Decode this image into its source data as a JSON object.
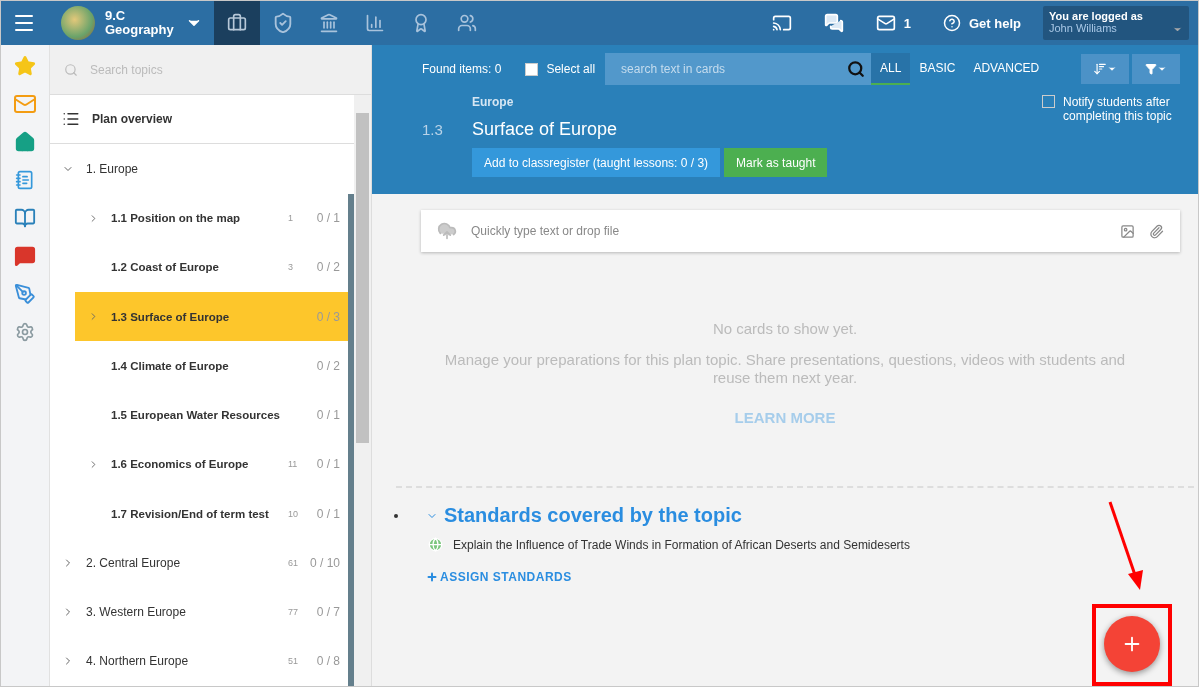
{
  "topbar": {
    "class_line1": "9.C",
    "class_line2": "Geography",
    "nav": [
      {
        "kind": "briefcase",
        "selected": true
      },
      {
        "kind": "shield",
        "selected": false
      },
      {
        "kind": "institution",
        "selected": false
      },
      {
        "kind": "chart",
        "selected": false
      },
      {
        "kind": "grade",
        "selected": false
      },
      {
        "kind": "students",
        "selected": false
      }
    ],
    "mail_count": "1",
    "help": "Get help",
    "login_label": "You are logged as",
    "user": "John Williams"
  },
  "rail": [
    {
      "kind": "star"
    },
    {
      "kind": "mail"
    },
    {
      "kind": "home"
    },
    {
      "kind": "notebook"
    },
    {
      "kind": "book"
    },
    {
      "kind": "chat"
    },
    {
      "kind": "pen"
    },
    {
      "kind": "settings"
    }
  ],
  "topics": {
    "search_placeholder": "Search topics",
    "overview": "Plan overview",
    "items": [
      {
        "label": "1. Europe",
        "expanded": true,
        "selected": false,
        "children": [
          {
            "label": "1.1  Position on the map",
            "count": "1",
            "progress": "0 / 1",
            "expandable": true,
            "selected": false
          },
          {
            "label": "1.2  Coast of Europe",
            "count": "3",
            "progress": "0 / 2",
            "expandable": false,
            "selected": false
          },
          {
            "label": "1.3  Surface of Europe",
            "progress": "0 / 3",
            "expandable": true,
            "selected": true
          },
          {
            "label": "1.4  Climate of Europe",
            "progress": "0 / 2",
            "expandable": false,
            "selected": false
          },
          {
            "label": "1.5  European Water Resources",
            "progress": "0 / 1",
            "expandable": false,
            "selected": false
          },
          {
            "label": "1.6  Economics of Europe",
            "count": "11",
            "progress": "0 / 1",
            "expandable": true,
            "selected": false
          },
          {
            "label": "1.7  Revision/End of term test",
            "count": "10",
            "progress": "0 / 1",
            "expandable": false,
            "selected": false
          }
        ]
      },
      {
        "label": "2. Central Europe",
        "count": "61",
        "progress": "0 / 10",
        "expanded": false,
        "selected": false
      },
      {
        "label": "3. Western Europe",
        "count": "77",
        "progress": "0 / 7",
        "expanded": false,
        "selected": false
      },
      {
        "label": "4. Northern Europe",
        "count": "51",
        "progress": "0 / 8",
        "expanded": false,
        "selected": false
      }
    ]
  },
  "toolbar": {
    "found": "Found items: 0",
    "select_all": {
      "label": "Select all",
      "checked": false
    },
    "search_placeholder": "search text in cards",
    "filters": [
      {
        "label": "ALL",
        "selected": true
      },
      {
        "label": "BASIC",
        "selected": false
      },
      {
        "label": "ADVANCED",
        "selected": false
      }
    ]
  },
  "topic": {
    "parent": "Europe",
    "number": "1.3",
    "title": "Surface of Europe",
    "register_button": "Add to classregister (taught lessons: 0 / 3)",
    "taught_button": "Mark as taught",
    "notify": {
      "label": "Notify students after completing this topic",
      "checked": false
    }
  },
  "composer": {
    "placeholder": "Quickly type text or drop file"
  },
  "empty": {
    "title": "No cards to show yet.",
    "text": "Manage your preparations for this plan topic. Share presentations, questions, videos with students and reuse them next year.",
    "link": "LEARN MORE"
  },
  "standards": {
    "heading": "Standards covered by the topic",
    "items": [
      "Explain the Influence of Trade Winds in Formation of African Deserts and Semideserts"
    ],
    "assign": "ASSIGN STANDARDS"
  }
}
